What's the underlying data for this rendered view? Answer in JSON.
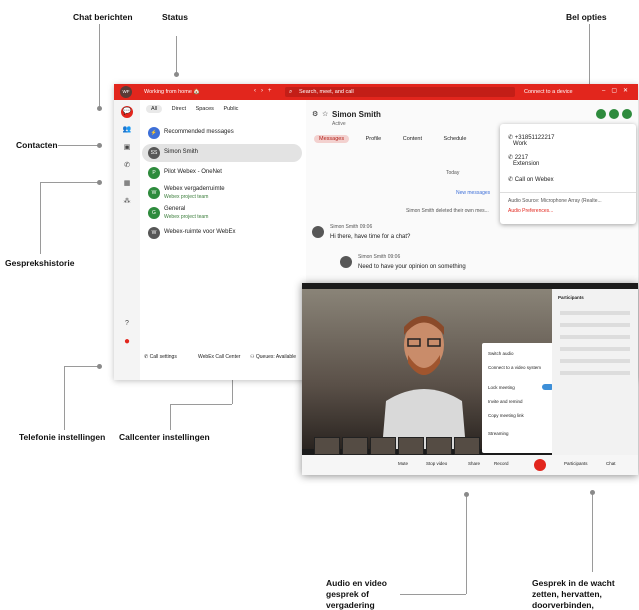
{
  "callouts": {
    "chat_berichten": "Chat berichten",
    "status": "Status",
    "bel_opties": "Bel opties",
    "contacten": "Contacten",
    "gespreks_historie": "Gespreks­historie",
    "telefonie_instellingen": "Telefonie instellingen",
    "callcenter_instellingen": "Callcenter instellingen",
    "audio_video": "Audio en video gesprek of vergadering",
    "wacht": "Gesprek in de wacht zetten, hervatten, doorverbinden, groepsgesprek"
  },
  "titlebar": {
    "avatar": "WF",
    "status": "Working from home 🏠",
    "search_placeholder": "Search, meet, and call",
    "connect": "Connect to a device"
  },
  "filters": [
    "All",
    "Direct",
    "Spaces",
    "Public"
  ],
  "list": [
    {
      "initials": "⚡",
      "title": "Recommended messages",
      "sub": ""
    },
    {
      "initials": "SS",
      "title": "Simon Smith",
      "sub": ""
    },
    {
      "initials": "P",
      "title": "Pilot Webex - OneNet",
      "sub": ""
    },
    {
      "initials": "W",
      "title": "Webex vergaderruimte",
      "sub": "Webex project team"
    },
    {
      "initials": "G",
      "title": "General",
      "sub": "Webex project team"
    },
    {
      "initials": "W",
      "title": "Webex-ruimte voor WebEx",
      "sub": ""
    }
  ],
  "bottom": {
    "call_settings": "Call settings",
    "call_center": "WebEx Call Center",
    "queues": "Queues: Available"
  },
  "chat": {
    "name": "Simon Smith",
    "presence": "Active",
    "tabs": [
      "Messages",
      "Profile",
      "Content",
      "Schedule"
    ],
    "today": "Today",
    "new_messages": "New messages",
    "deleted": "Simon Smith deleted their own mes...",
    "m1_meta": "Simon Smith 09:06",
    "m1_text": "Hi there, have time for a chat?",
    "m2_meta": "Simon Smith 09:06",
    "m2_text": "Need to have your opinion on something"
  },
  "popup": {
    "number": "+31851122217",
    "number_label": "Work",
    "ext": "2217",
    "ext_label": "Extension",
    "webex": "Call on Webex",
    "audio_source": "Audio Source: Microphone Array (Realte...",
    "audio_prefs": "Audio Preferences..."
  },
  "meeting": {
    "participants": "Participants",
    "mute": "Mute",
    "stop_video": "Stop video",
    "share": "Share",
    "record": "Record",
    "chat": "Chat",
    "menu": [
      "Switch audio",
      "Connect to a video system",
      "Lock meeting",
      "Invite and remind",
      "Copy meeting link",
      "Streaming"
    ]
  },
  "colors": {
    "brand": "#e2261d",
    "accent_green": "#2e8b3d"
  }
}
